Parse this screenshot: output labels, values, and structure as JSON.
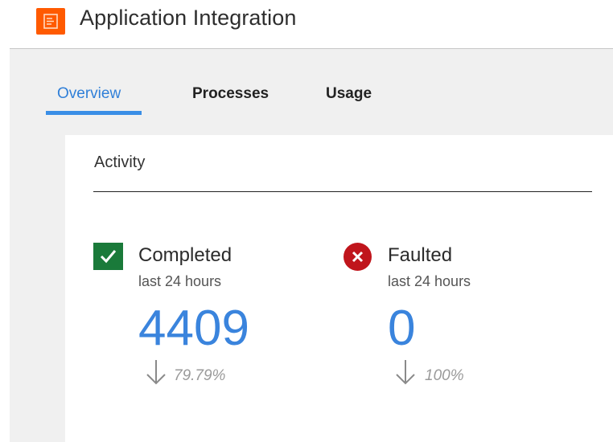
{
  "app": {
    "title": "Application Integration",
    "accent": "#ff5a00",
    "logo_icon": "document-icon"
  },
  "tabs": [
    {
      "label": "Overview",
      "active": true
    },
    {
      "label": "Processes",
      "active": false
    },
    {
      "label": "Usage",
      "active": false
    }
  ],
  "activity": {
    "title": "Activity",
    "completed": {
      "label": "Completed",
      "period": "last 24 hours",
      "value": "4409",
      "change": "79.79%",
      "trend": "down",
      "icon": "check-icon",
      "color": "#1a7a3a"
    },
    "faulted": {
      "label": "Faulted",
      "period": "last 24 hours",
      "value": "0",
      "change": "100%",
      "trend": "down",
      "icon": "x-circle-icon",
      "color": "#c0151c"
    }
  },
  "colors": {
    "tab_active": "#2f7fd8",
    "value": "#3a84dd",
    "background": "#f0f0f0"
  }
}
